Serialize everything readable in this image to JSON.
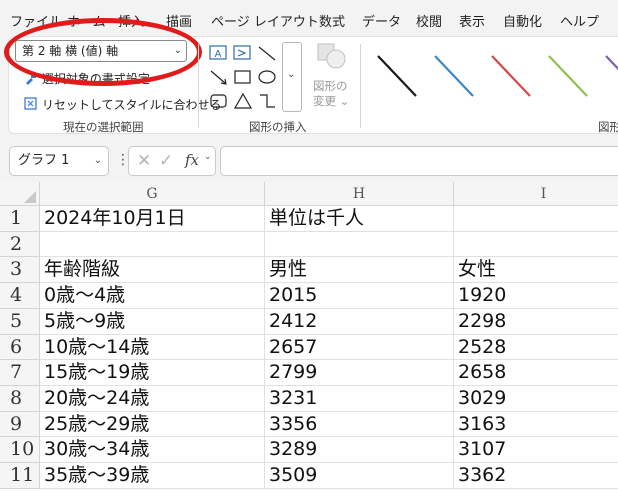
{
  "menu": [
    "ファイル",
    "ホーム",
    "挿入",
    "描画",
    "ページ レイアウト",
    "数式",
    "データ",
    "校閲",
    "表示",
    "自動化",
    "ヘルプ"
  ],
  "ribbon": {
    "element_select": "第 2 軸 横 (値) 軸",
    "format_selection": "選択対象の書式設定",
    "reset_style": "リセットしてスタイルに合わせる",
    "current_selection_label": "現在の選択範囲",
    "change_shape_line1": "図形の",
    "change_shape_line2": "変更",
    "insert_shapes_label": "図形の挿入",
    "shape_styles_label": "図形",
    "line_style_colors": [
      "#1a1a1a",
      "#3b86c6",
      "#d24a4a",
      "#8cc152",
      "#7f5fb8"
    ]
  },
  "formula_bar": {
    "name_box": "グラフ 1",
    "formula": ""
  },
  "grid": {
    "columns": [
      "G",
      "H",
      "I"
    ],
    "rows": [
      {
        "num": "1",
        "cells": [
          "2024年10月1日",
          "単位は千人",
          ""
        ]
      },
      {
        "num": "2",
        "cells": [
          "",
          "",
          ""
        ]
      },
      {
        "num": "3",
        "cells": [
          "年齢階級",
          "男性",
          "女性"
        ]
      },
      {
        "num": "4",
        "cells": [
          "0歳～4歳",
          "2015",
          "1920"
        ]
      },
      {
        "num": "5",
        "cells": [
          "5歳～9歳",
          "2412",
          "2298"
        ]
      },
      {
        "num": "6",
        "cells": [
          "10歳～14歳",
          "2657",
          "2528"
        ]
      },
      {
        "num": "7",
        "cells": [
          "15歳～19歳",
          "2799",
          "2658"
        ]
      },
      {
        "num": "8",
        "cells": [
          "20歳～24歳",
          "3231",
          "3029"
        ]
      },
      {
        "num": "9",
        "cells": [
          "25歳～29歳",
          "3356",
          "3163"
        ]
      },
      {
        "num": "10",
        "cells": [
          "30歳～34歳",
          "3289",
          "3107"
        ]
      },
      {
        "num": "11",
        "cells": [
          "35歳～39歳",
          "3509",
          "3362"
        ]
      }
    ]
  },
  "annotation": {
    "oval_color": "#e11b1b"
  }
}
